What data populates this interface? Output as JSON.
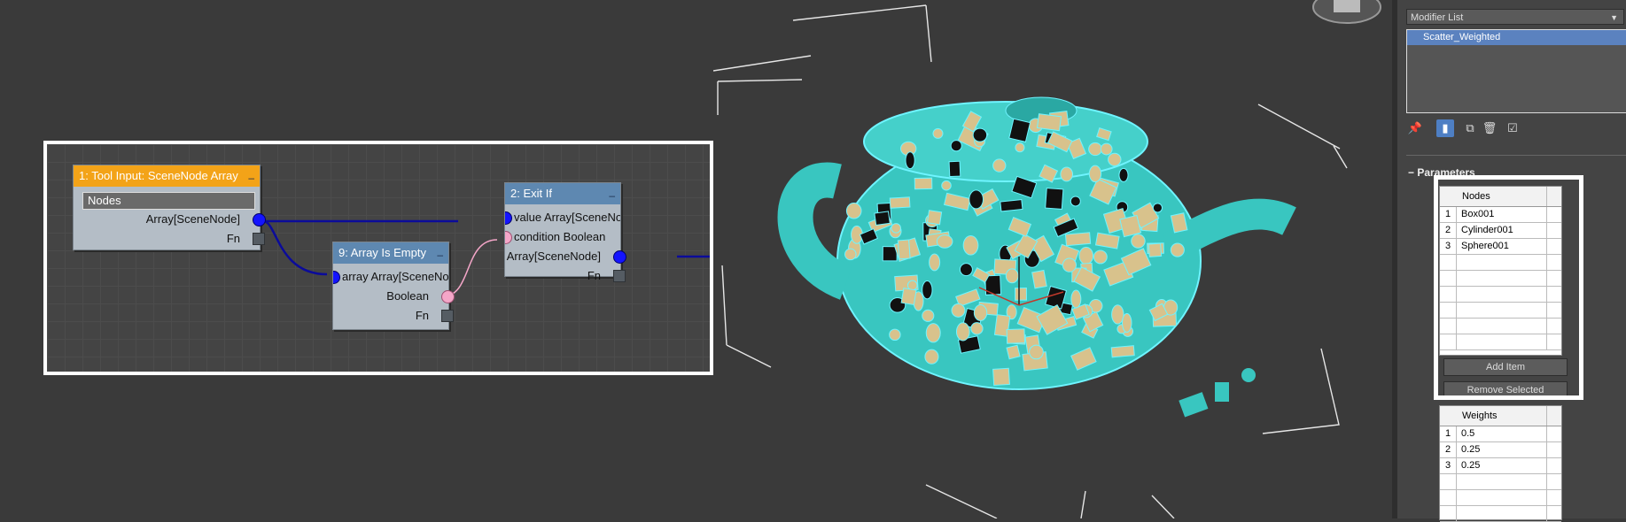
{
  "node_editor": {
    "nodes": [
      {
        "id": "tool_input",
        "title": "1: Tool Input: SceneNode Array",
        "field": "Nodes",
        "out": "Array[SceneNode]",
        "fn": "Fn"
      },
      {
        "id": "array_empty",
        "title": "9: Array Is Empty",
        "in": "array Array[SceneNo...",
        "out": "Boolean",
        "fn": "Fn"
      },
      {
        "id": "exit_if",
        "title": "2: Exit If",
        "in1": "value Array[SceneNo...",
        "in2": "condition Boolean",
        "out": "Array[SceneNode]",
        "fn": "Fn"
      }
    ],
    "min_glyph": "–"
  },
  "panel": {
    "modifier_list": "Modifier List",
    "modifier_stack": [
      "Scatter_Weighted"
    ],
    "rollout_title": "Parameters",
    "nodes_table": {
      "header": "Nodes",
      "rows": [
        {
          "n": "1",
          "v": "Box001"
        },
        {
          "n": "2",
          "v": "Cylinder001"
        },
        {
          "n": "3",
          "v": "Sphere001"
        }
      ]
    },
    "add_item": "Add Item",
    "remove_selected": "Remove Selected",
    "weights_table": {
      "header": "Weights",
      "rows": [
        {
          "n": "1",
          "v": "0.5"
        },
        {
          "n": "2",
          "v": "0.25"
        },
        {
          "n": "3",
          "v": "0.25"
        }
      ]
    },
    "toolbar_icons": [
      "pin-icon",
      "stack-icon",
      "show-end-icon",
      "unique-icon",
      "delete-icon",
      "configure-icon"
    ]
  },
  "viewport": {
    "label": "3D viewport with scattered objects on teapot",
    "colors": {
      "teapot": "#39c6c0",
      "boxes": "#d8c28c",
      "outline": "#6ff4ff"
    }
  }
}
